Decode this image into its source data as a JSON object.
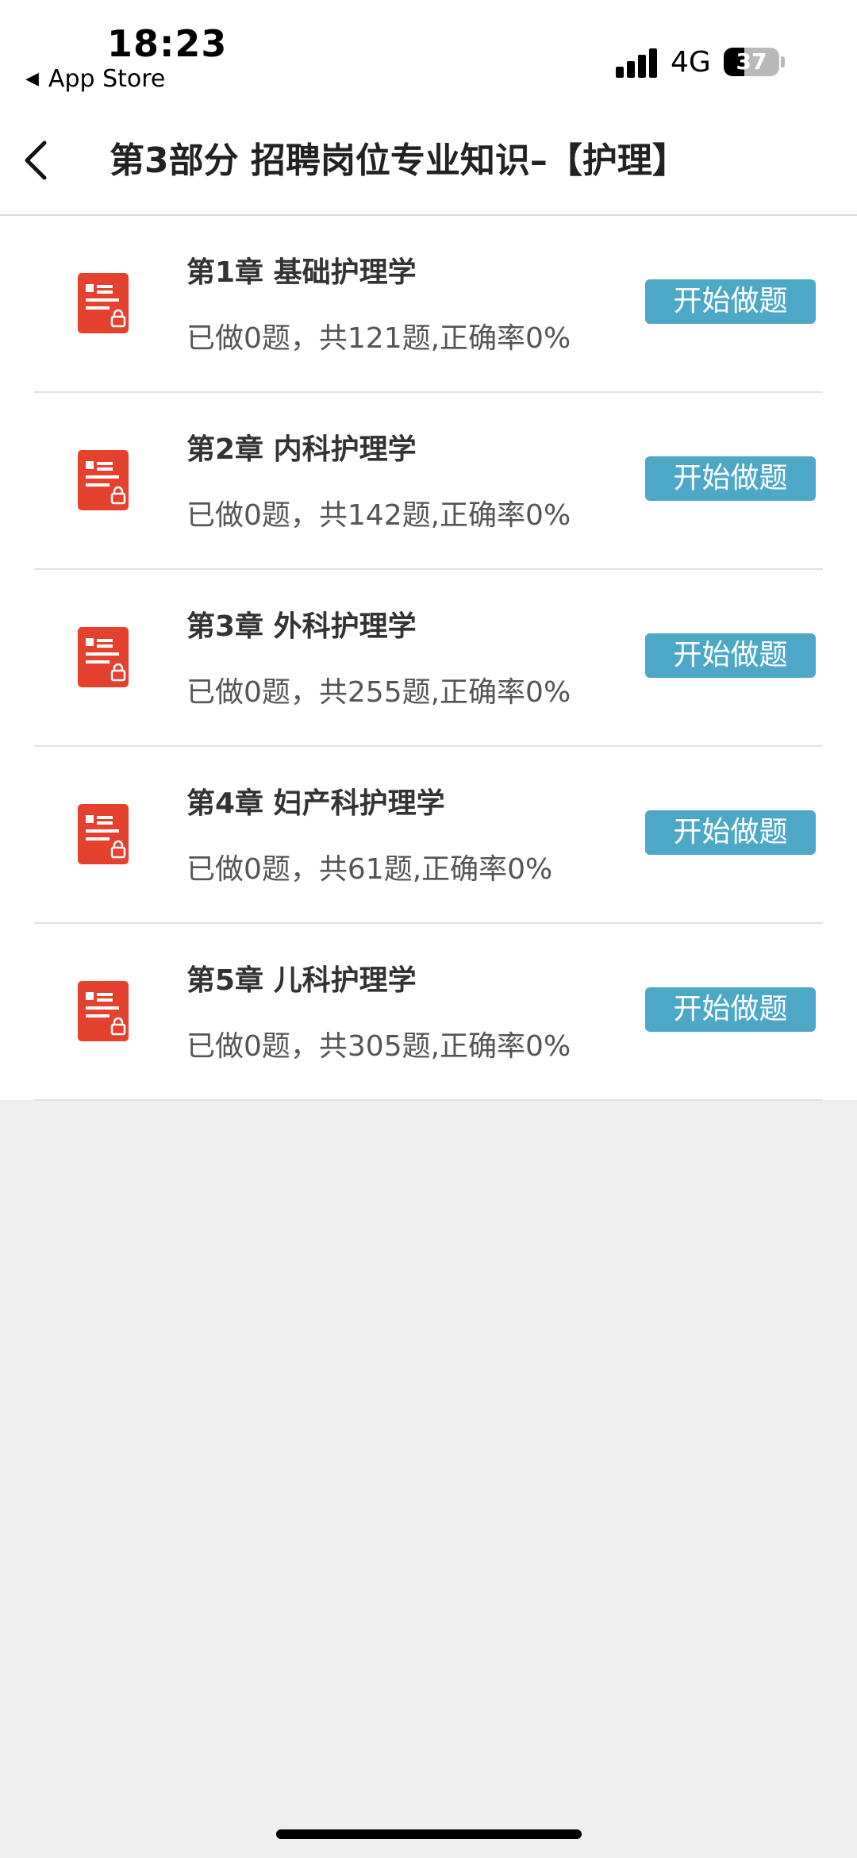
{
  "status_bar": {
    "time": "18:23",
    "back_app": "App Store",
    "network": "4G",
    "battery": "37"
  },
  "nav": {
    "title": "第3部分 招聘岗位专业知识–【护理】",
    "back_icon": "chevron-left-icon"
  },
  "chapters": [
    {
      "title": "第1章  基础护理学",
      "stats": "已做0题，共121题,正确率0%",
      "button": "开始做题"
    },
    {
      "title": "第2章  内科护理学",
      "stats": "已做0题，共142题,正确率0%",
      "button": "开始做题"
    },
    {
      "title": "第3章  外科护理学",
      "stats": "已做0题，共255题,正确率0%",
      "button": "开始做题"
    },
    {
      "title": "第4章  妇产科护理学",
      "stats": "已做0题，共61题,正确率0%",
      "button": "开始做题"
    },
    {
      "title": "第5章  儿科护理学",
      "stats": "已做0题，共305题,正确率0%",
      "button": "开始做题"
    }
  ],
  "colors": {
    "button_bg": "#4da8c8",
    "icon_red": "#e4412f",
    "page_bg": "#efefef"
  }
}
